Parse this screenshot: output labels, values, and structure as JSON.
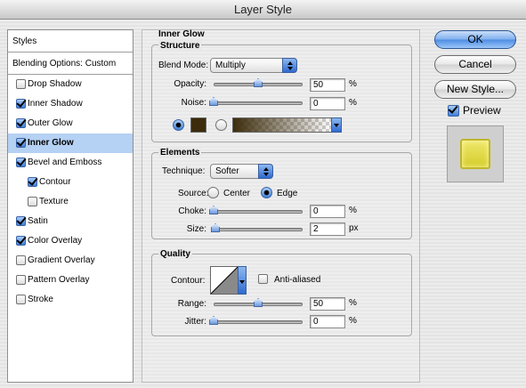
{
  "window": {
    "title": "Layer Style"
  },
  "sidebar": {
    "header": "Styles",
    "blending_options": "Blending Options: Custom",
    "items": [
      {
        "label": "Drop Shadow",
        "checked": false,
        "selected": false,
        "sub": false
      },
      {
        "label": "Inner Shadow",
        "checked": true,
        "selected": false,
        "sub": false
      },
      {
        "label": "Outer Glow",
        "checked": true,
        "selected": false,
        "sub": false
      },
      {
        "label": "Inner Glow",
        "checked": true,
        "selected": true,
        "sub": false
      },
      {
        "label": "Bevel and Emboss",
        "checked": true,
        "selected": false,
        "sub": false
      },
      {
        "label": "Contour",
        "checked": true,
        "selected": false,
        "sub": true
      },
      {
        "label": "Texture",
        "checked": false,
        "selected": false,
        "sub": true
      },
      {
        "label": "Satin",
        "checked": true,
        "selected": false,
        "sub": false
      },
      {
        "label": "Color Overlay",
        "checked": true,
        "selected": false,
        "sub": false
      },
      {
        "label": "Gradient Overlay",
        "checked": false,
        "selected": false,
        "sub": false
      },
      {
        "label": "Pattern Overlay",
        "checked": false,
        "selected": false,
        "sub": false
      },
      {
        "label": "Stroke",
        "checked": false,
        "selected": false,
        "sub": false
      }
    ]
  },
  "panel": {
    "title": "Inner Glow",
    "structure": {
      "title": "Structure",
      "blend_mode_label": "Blend Mode:",
      "blend_mode_value": "Multiply",
      "opacity_label": "Opacity:",
      "opacity_value": "50",
      "opacity_unit": "%",
      "opacity_level": 0.5,
      "noise_label": "Noise:",
      "noise_value": "0",
      "noise_unit": "%",
      "noise_level": 0,
      "color_mode": "solid",
      "glow_color": "#3c2c0b"
    },
    "elements": {
      "title": "Elements",
      "technique_label": "Technique:",
      "technique_value": "Softer",
      "source_label": "Source:",
      "source_center": "Center",
      "source_edge": "Edge",
      "source_selected": "edge",
      "choke_label": "Choke:",
      "choke_value": "0",
      "choke_unit": "%",
      "size_label": "Size:",
      "size_value": "2",
      "size_unit": "px"
    },
    "quality": {
      "title": "Quality",
      "contour_label": "Contour:",
      "anti_aliased_label": "Anti-aliased",
      "anti_aliased": false,
      "range_label": "Range:",
      "range_value": "50",
      "range_unit": "%",
      "range_level": 0.5,
      "jitter_label": "Jitter:",
      "jitter_value": "0",
      "jitter_unit": "%"
    }
  },
  "buttons": {
    "ok": "OK",
    "cancel": "Cancel",
    "new_style": "New Style...",
    "preview_label": "Preview",
    "preview_checked": true
  },
  "colors": {
    "selection": "#b5d1f3",
    "accent": "#4d8ce3",
    "preview_fill": "#e6df4a"
  },
  "icons": [
    "checkbox-icon",
    "radio-icon",
    "popup-arrow-icon",
    "slider-thumb-icon",
    "contour-curve-icon"
  ]
}
